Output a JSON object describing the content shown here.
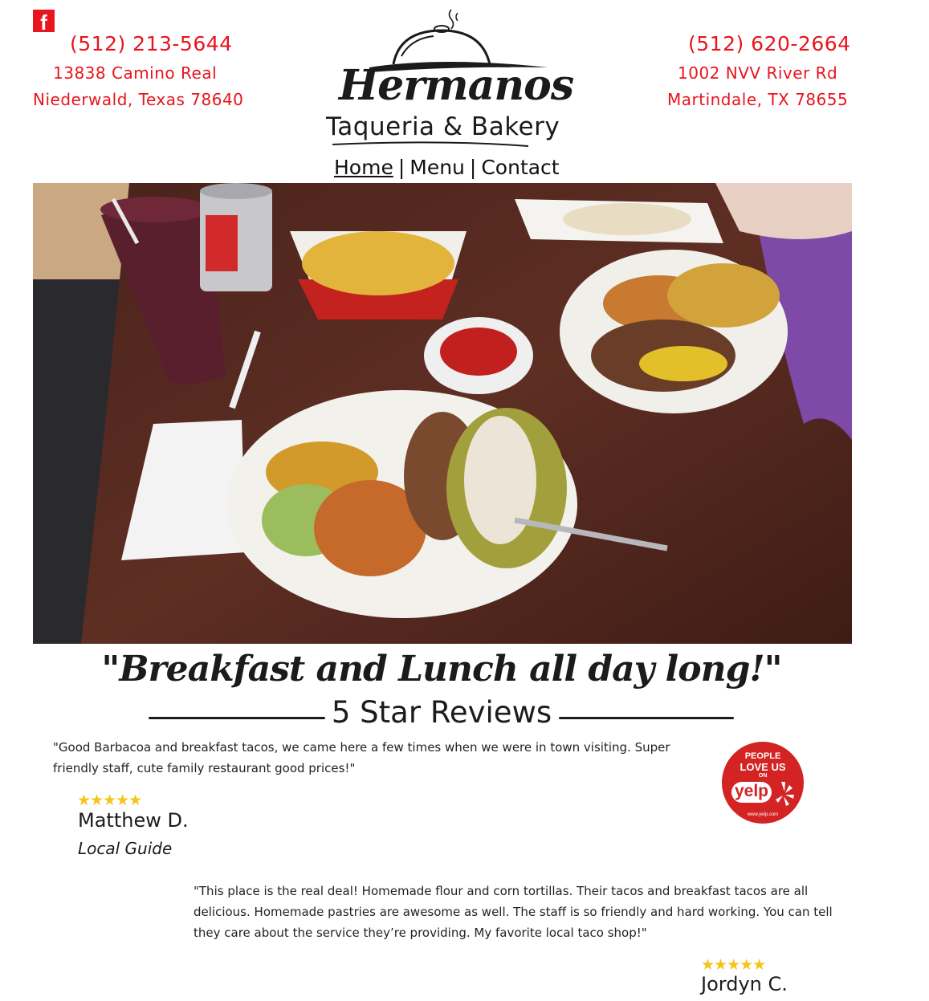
{
  "social": {
    "facebook_glyph": "f"
  },
  "left_location": {
    "phone": "(512) 213-5644",
    "address_line1": "13838 Camino Real",
    "address_line2": "Niederwald, Texas 78640"
  },
  "right_location": {
    "phone": "(512) 620-2664",
    "address_line1": "1002 NVV River Rd",
    "address_line2": "Martindale, TX 78655"
  },
  "logo": {
    "name": "Hermanos",
    "subtitle": "Taqueria & Bakery"
  },
  "nav": {
    "items": [
      "Home",
      "Menu",
      "Contact"
    ],
    "separator": "|",
    "active": "Home"
  },
  "tagline": "\"Breakfast and Lunch all day long!\"",
  "reviews_section": {
    "title": "5 Star Reviews",
    "reviews": [
      {
        "text": "\"Good Barbacoa and breakfast tacos, we came here a few times when we were in town visiting. Super friendly staff, cute family restaurant good prices!\"",
        "stars": "★★★★★",
        "rating": 5,
        "name": "Matthew D.",
        "role": "Local Guide"
      },
      {
        "text": "\"This place is the real deal! Homemade flour and corn tortillas. Their tacos and breakfast tacos are all delicious. Homemade pastries are awesome as well. The staff is so friendly and hard working. You can tell they care about the service they’re providing. My favorite local taco shop!\"",
        "stars": "★★★★★",
        "rating": 5,
        "name": "Jordyn C."
      }
    ]
  },
  "yelp_badge": {
    "line1": "PEOPLE",
    "line2": "LOVE US",
    "line3": "ON",
    "brand": "yelp",
    "url": "www.yelp.com"
  },
  "colors": {
    "accent": "#e8141e",
    "text": "#1b1b1b",
    "yelp": "#d32323",
    "star": "#f5c518"
  }
}
